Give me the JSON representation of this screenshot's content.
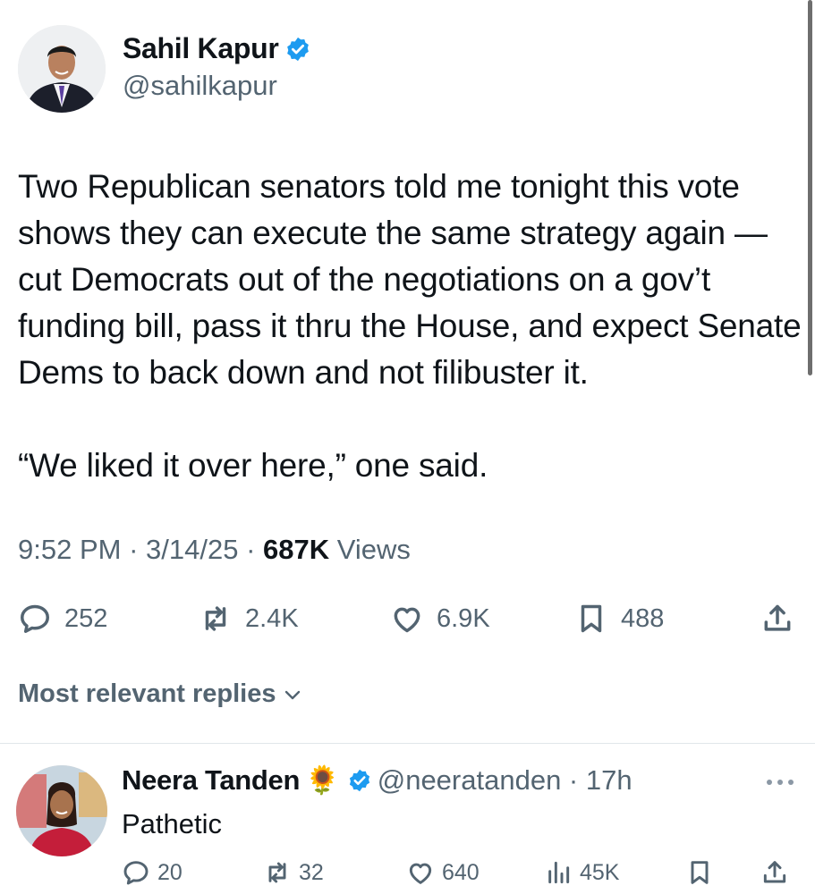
{
  "tweet": {
    "author": {
      "name": "Sahil Kapur",
      "handle": "@sahilkapur",
      "verified": true
    },
    "text": "Two Republican senators told me tonight this vote shows they can execute the same strategy again — cut Democrats out of the negotiations on a gov’t funding bill, pass it thru the House, and expect Senate Dems to back down and not filibuster it.\n\n“We liked it over here,” one said.",
    "time": "9:52 PM",
    "sep1": " · ",
    "date": "3/14/25",
    "sep2": " · ",
    "views_count": "687K",
    "views_label": " Views",
    "stats": {
      "replies": "252",
      "reposts": "2.4K",
      "likes": "6.9K",
      "bookmarks": "488"
    }
  },
  "replies_sort": {
    "label": "Most relevant replies"
  },
  "reply": {
    "author": {
      "name": "Neera Tanden",
      "emoji": "🌻",
      "handle": "@neeratanden",
      "sep": " · ",
      "time": "17h",
      "verified": true
    },
    "text": "Pathetic",
    "stats": {
      "replies": "20",
      "reposts": "32",
      "likes": "640",
      "views": "45K"
    }
  },
  "colors": {
    "text_primary": "#0f1419",
    "text_secondary": "#536471",
    "verified_blue": "#1d9bf0"
  },
  "icons": [
    "verified-badge-icon",
    "reply-icon",
    "repost-icon",
    "like-icon",
    "bookmark-icon",
    "share-icon",
    "chevron-down-icon",
    "more-icon",
    "views-icon"
  ]
}
